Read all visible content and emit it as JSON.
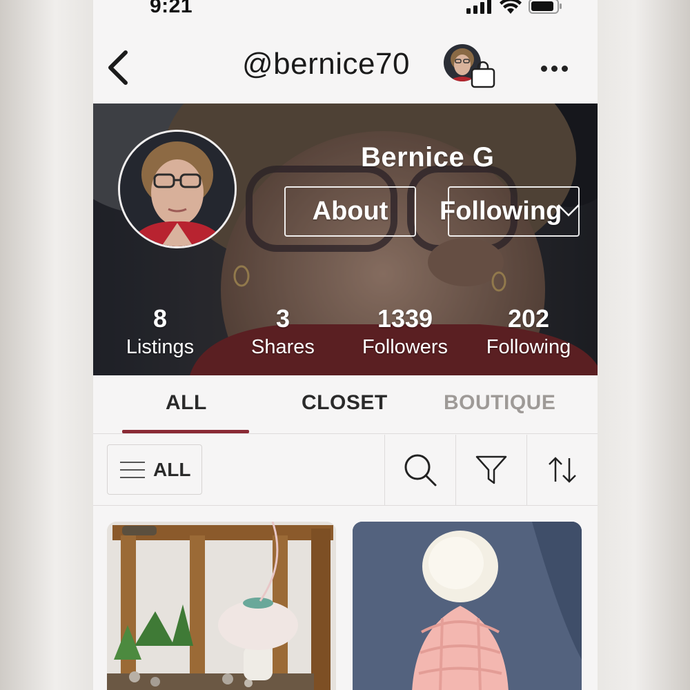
{
  "status_bar": {
    "time": "9:21"
  },
  "nav": {
    "username": "@bernice70",
    "back_icon": "chevron-left-icon",
    "more_icon": "more-horizontal-icon",
    "bag_icon": "shopping-bag-icon"
  },
  "profile": {
    "name": "Bernice G",
    "about_label": "About",
    "following_label": "Following",
    "stats": [
      {
        "value": "8",
        "label": "Listings"
      },
      {
        "value": "3",
        "label": "Shares"
      },
      {
        "value": "1339",
        "label": "Followers"
      },
      {
        "value": "202",
        "label": "Following"
      }
    ]
  },
  "tabs": [
    {
      "label": "ALL",
      "active": true
    },
    {
      "label": "CLOSET",
      "active": false
    },
    {
      "label": "BOUTIQUE",
      "active": false
    }
  ],
  "filter_bar": {
    "dropdown_label": "ALL",
    "icons": [
      "search-icon",
      "filter-icon",
      "sort-icon"
    ]
  },
  "listings": [
    {
      "image": "crochet mushroom ornament in wooden lantern"
    },
    {
      "image": "pink knit beanie with white pom pom"
    }
  ],
  "colors": {
    "accent": "#8a2a35",
    "inactive_tab": "#9e9a97",
    "background": "#f6f5f5"
  }
}
